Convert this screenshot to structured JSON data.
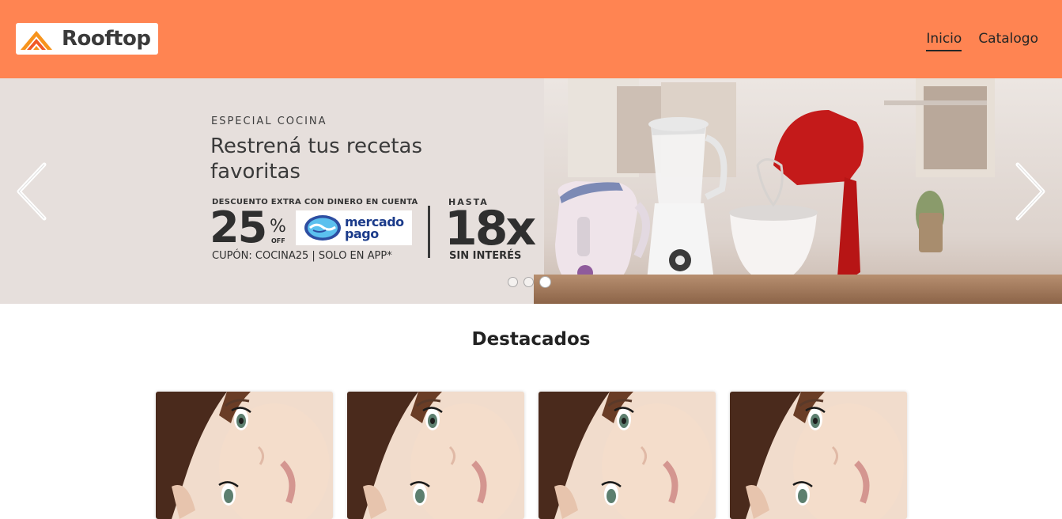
{
  "header": {
    "brand": "Rooftop",
    "logo_icon": "rooftop-logo-icon",
    "nav": [
      {
        "label": "Inicio",
        "active": true
      },
      {
        "label": "Catalogo",
        "active": false
      }
    ],
    "bg_color": "#ff8452"
  },
  "carousel": {
    "slide": {
      "kicker": "ESPECIAL COCINA",
      "title": "Restrená tus recetas favoritas",
      "extra_discount": "DESCUENTO EXTRA CON DINERO EN CUENTA",
      "percent": "25",
      "percent_symbol": "%",
      "off": "OFF",
      "payment_brand": "mercado pago",
      "payment_brand_line1": "mercado",
      "payment_brand_line2": "pago",
      "coupon": "CUPÓN: COCINA25 | SOLO EN APP*",
      "hasta": "HASTA",
      "installments": "18x",
      "installments_note": "SIN INTERÉS"
    },
    "prev_icon": "chevron-left-icon",
    "next_icon": "chevron-right-icon",
    "dots": 3,
    "active_dot": 3
  },
  "featured": {
    "title": "Destacados",
    "cards": [
      {
        "image": "portrait-photo"
      },
      {
        "image": "portrait-photo"
      },
      {
        "image": "portrait-photo"
      },
      {
        "image": "portrait-photo"
      }
    ]
  }
}
